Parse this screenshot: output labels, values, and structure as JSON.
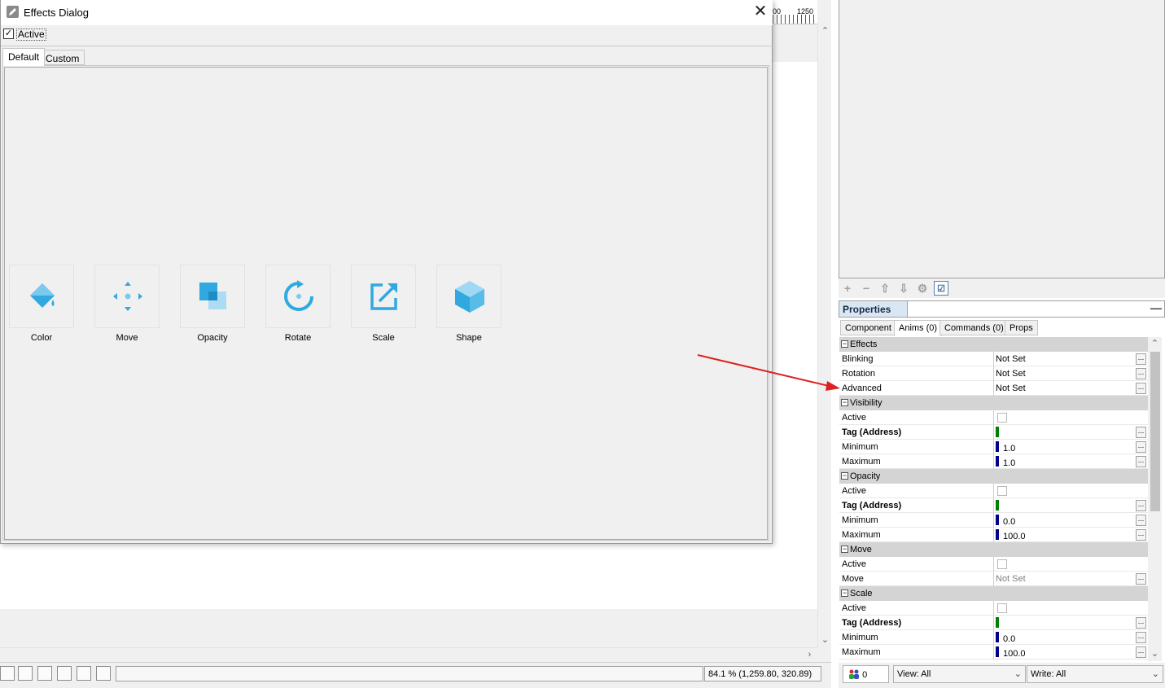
{
  "dialog": {
    "title": "Effects Dialog",
    "close_glyph": "✕",
    "active_label": "Active",
    "active_checked": true,
    "tabs": [
      {
        "label": "Default",
        "active": true
      },
      {
        "label": "Custom",
        "active": false
      }
    ],
    "effects": [
      {
        "label": "Color",
        "icon": "paint-bucket-icon"
      },
      {
        "label": "Move",
        "icon": "move-arrows-icon"
      },
      {
        "label": "Opacity",
        "icon": "opacity-squares-icon"
      },
      {
        "label": "Rotate",
        "icon": "rotate-icon"
      },
      {
        "label": "Scale",
        "icon": "scale-icon"
      },
      {
        "label": "Shape",
        "icon": "cube-icon"
      }
    ],
    "icon_color": "#2fa9e0"
  },
  "ruler": {
    "label_left": "00",
    "label_right": "1250"
  },
  "statusbar": {
    "zoom_text": "84.1 %  (1,259.80, 320.89)"
  },
  "properties": {
    "title": "Properties",
    "minimize_glyph": "—",
    "tabs": [
      {
        "label": "Component",
        "active": false
      },
      {
        "label": "Anims (0)",
        "active": true
      },
      {
        "label": "Commands (0)",
        "active": false
      },
      {
        "label": "Props",
        "active": false
      }
    ],
    "ellipsis": "...",
    "categories": {
      "effects": {
        "label": "Effects",
        "rows": {
          "blinking": {
            "name": "Blinking",
            "value": "Not Set"
          },
          "rotation": {
            "name": "Rotation",
            "value": "Not Set"
          },
          "advanced": {
            "name": "Advanced",
            "value": "Not Set"
          }
        }
      },
      "visibility": {
        "label": "Visibility",
        "rows": {
          "active": {
            "name": "Active"
          },
          "tag": {
            "name": "Tag (Address)"
          },
          "minimum": {
            "name": "Minimum",
            "value": "1.0"
          },
          "maximum": {
            "name": "Maximum",
            "value": "1.0"
          }
        }
      },
      "opacity": {
        "label": "Opacity",
        "rows": {
          "active": {
            "name": "Active"
          },
          "tag": {
            "name": "Tag (Address)"
          },
          "minimum": {
            "name": "Minimum",
            "value": "0.0"
          },
          "maximum": {
            "name": "Maximum",
            "value": "100.0"
          }
        }
      },
      "move": {
        "label": "Move",
        "rows": {
          "active": {
            "name": "Active"
          },
          "move": {
            "name": "Move",
            "value": "Not Set"
          }
        }
      },
      "scale": {
        "label": "Scale",
        "rows": {
          "active": {
            "name": "Active"
          },
          "tag": {
            "name": "Tag (Address)"
          },
          "minimum": {
            "name": "Minimum",
            "value": "0.0"
          },
          "maximum": {
            "name": "Maximum",
            "value": "100.0"
          }
        }
      }
    },
    "colors": {
      "tag_bar": "#008000",
      "value_bar": "#00008b",
      "annotation_arrow": "#e02020"
    }
  },
  "footer": {
    "user_count": "0",
    "view_label": "View: All",
    "write_label": "Write: All"
  }
}
